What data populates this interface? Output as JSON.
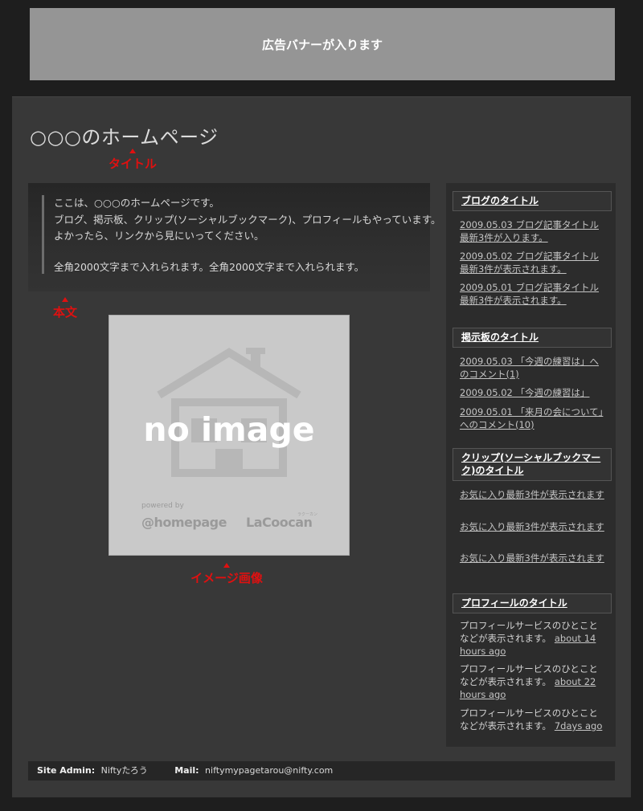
{
  "banner": {
    "text": "広告バナーが入ります"
  },
  "page": {
    "title": "○○○のホームページ"
  },
  "annotations": {
    "title": "タイトル",
    "body": "本文",
    "image": "イメージ画像"
  },
  "body": {
    "lines": [
      "ここは、○○○のホームページです。",
      "ブログ、掲示板、クリップ(ソーシャルブックマーク)、プロフィールもやっています。",
      "よかったら、リンクから見にいってください。",
      "全角2000文字まで入れられます。全角2000文字まで入れられます。"
    ]
  },
  "image": {
    "main_text": "no image",
    "powered_by": "powered by",
    "brand1": "@homepage",
    "brand2": "LaCoocan",
    "brand2_ruby": "ラクーカン"
  },
  "sidebar": {
    "blog": {
      "title": "ブログのタイトル",
      "items": [
        "2009.05.03 ブログ記事タイトル最新3件が入ります。",
        "2009.05.02 ブログ記事タイトル最新3件が表示されます。",
        "2009.05.01 ブログ記事タイトル最新3件が表示されます。"
      ]
    },
    "bbs": {
      "title": "掲示板のタイトル",
      "items": [
        "2009.05.03 「今週の練習は」へのコメント(1)",
        "2009.05.02 「今週の練習は」",
        "2009.05.01 「来月の会について」へのコメント(10)"
      ]
    },
    "clip": {
      "title": "クリップ(ソーシャルブックマーク)のタイトル",
      "items": [
        "お気に入り最新3件が表示されます",
        "お気に入り最新3件が表示されます",
        "お気に入り最新3件が表示されます"
      ]
    },
    "profile": {
      "title": "プロフィールのタイトル",
      "items": [
        {
          "text": "プロフィールサービスのひとことなどが表示されます。",
          "ago": "about 14 hours ago"
        },
        {
          "text": "プロフィールサービスのひとことなどが表示されます。",
          "ago": "about 22 hours ago"
        },
        {
          "text": "プロフィールサービスのひとことなどが表示されます。",
          "ago": "7days ago"
        }
      ]
    }
  },
  "footer": {
    "admin_label": "Site Admin:",
    "admin_value": "Niftyたろう",
    "mail_label": "Mail:",
    "mail_value": "niftymypagetarou@nifty.com"
  },
  "colors": {
    "annotation": "#e01010",
    "background": "#1e1e1e",
    "panel": "#383838",
    "banner": "#959595"
  }
}
